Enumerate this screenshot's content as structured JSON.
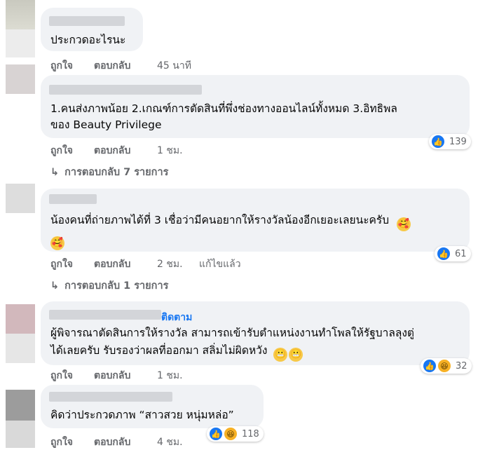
{
  "comments": [
    {
      "text_lines": [
        "ประกวดอะไรนะ"
      ],
      "actions": {
        "like": "ถูกใจ",
        "reply": "ตอบกลับ",
        "time": "45 นาที"
      }
    },
    {
      "text_lines": [
        "1.คนส่งภาพน้อย 2.เกณฑ์การตัดสินที่พึ่งช่องทางออนไลน์ทั้งหมด 3.อิทธิพล",
        "ของ Beauty Privilege"
      ],
      "actions": {
        "like": "ถูกใจ",
        "reply": "ตอบกลับ",
        "time": "1 ชม."
      },
      "reactions": {
        "icons": [
          "like-icon"
        ],
        "count": "139"
      },
      "replies": "การตอบกลับ 7 รายการ"
    },
    {
      "text_lines": [
        "น้องคนที่ถ่ายภาพได้ที่ 3 เชื่อว่ามีคนอยากให้รางวัลน้องอีกเยอะเลยนะครับ"
      ],
      "emoji": "🥰",
      "actions": {
        "like": "ถูกใจ",
        "reply": "ตอบกลับ",
        "time": "2 ชม.",
        "edited": "แก้ไขแล้ว"
      },
      "reactions": {
        "icons": [
          "like-icon"
        ],
        "count": "61"
      },
      "replies": "การตอบกลับ 1 รายการ"
    },
    {
      "follow": "ติดตาม",
      "text_lines": [
        "ผู้พิจารณาตัดสินการให้รางวัล สามารถเข้ารับตำแหน่งงานทำโพลให้รัฐบาลลุงตู่",
        "ได้เลยครับ รับรองว่าผลที่ออกมา สลิ่มไม่ผิดหวัง"
      ],
      "emoji": "😬",
      "actions": {
        "like": "ถูกใจ",
        "reply": "ตอบกลับ",
        "time": "1 ชม."
      },
      "reactions": {
        "icons": [
          "like-icon",
          "haha-icon"
        ],
        "count": "32"
      }
    },
    {
      "text_lines": [
        "คิดว่าประกวดภาพ “สาวสวย หนุ่มหล่อ”"
      ],
      "actions": {
        "like": "ถูกใจ",
        "reply": "ตอบกลับ",
        "time": "4 ชม."
      },
      "reactions": {
        "icons": [
          "like-icon",
          "haha-icon"
        ],
        "count": "118"
      }
    }
  ],
  "colors": {
    "bubble": "#f0f2f5",
    "meta": "#65676b",
    "link": "#1877f2",
    "like": "#1877f2"
  }
}
